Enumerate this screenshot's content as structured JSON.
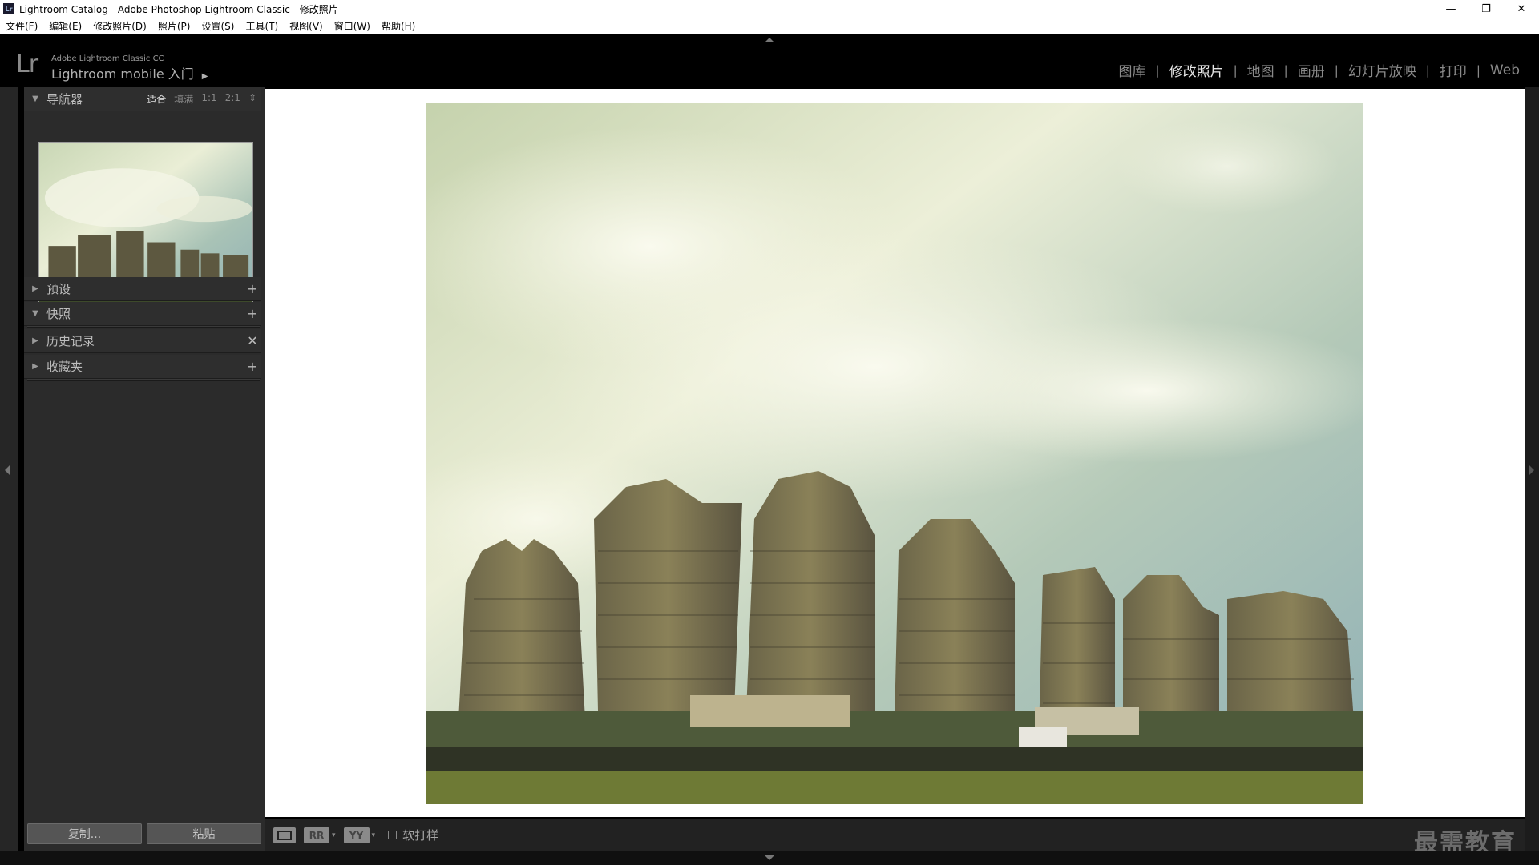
{
  "window": {
    "app_icon": "Lr",
    "title": "Lightroom Catalog - Adobe Photoshop Lightroom Classic - 修改照片",
    "minimize_glyph": "—",
    "restore_glyph": "❐",
    "close_glyph": "✕"
  },
  "menu": [
    "文件(F)",
    "编辑(E)",
    "修改照片(D)",
    "照片(P)",
    "设置(S)",
    "工具(T)",
    "视图(V)",
    "窗口(W)",
    "帮助(H)"
  ],
  "identity": {
    "logo": "Lr",
    "product": "Adobe Lightroom Classic CC",
    "mobile": "Lightroom mobile 入门",
    "mobile_arrow": "▶"
  },
  "modules": [
    {
      "label": "图库",
      "active": false
    },
    {
      "label": "修改照片",
      "active": true
    },
    {
      "label": "地图",
      "active": false
    },
    {
      "label": "画册",
      "active": false
    },
    {
      "label": "幻灯片放映",
      "active": false
    },
    {
      "label": "打印",
      "active": false
    },
    {
      "label": "Web",
      "active": false
    }
  ],
  "module_separator": "|",
  "navigator": {
    "title": "导航器",
    "zoom_options": [
      "适合",
      "填满",
      "1:1",
      "2:1"
    ],
    "active_zoom": "适合",
    "stepper_glyph": "⇕"
  },
  "panels": {
    "presets": {
      "title": "预设",
      "action": "+",
      "expanded": false
    },
    "snapshots": {
      "title": "快照",
      "action": "+",
      "expanded": true
    },
    "history": {
      "title": "历史记录",
      "action": "✕",
      "expanded": false
    },
    "collections": {
      "title": "收藏夹",
      "action": "+",
      "expanded": false
    }
  },
  "bottom_buttons": {
    "copy": "复制...",
    "paste": "粘贴"
  },
  "toolbar": {
    "before_after_label": "RR",
    "yy_label": "YY",
    "caret": "▾",
    "soft_proof_label": "软打样",
    "soft_proof_checked": false
  },
  "watermark": "最需教育",
  "icons": {
    "expanded": "▼",
    "collapsed": "▶"
  }
}
